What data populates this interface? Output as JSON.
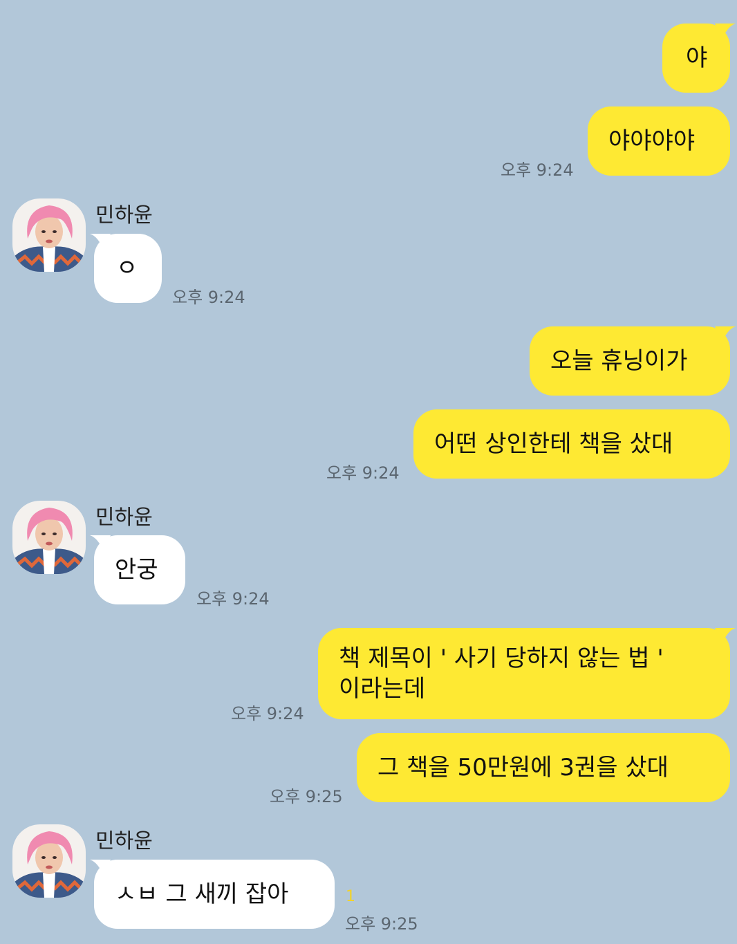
{
  "contact": {
    "name": "민하윤"
  },
  "colors": {
    "background": "#b2c7d9",
    "mine_bubble": "#fee933",
    "their_bubble": "#ffffff",
    "time_text": "#5b6670",
    "unread": "#f3d326"
  },
  "messages": [
    {
      "from": "me",
      "text": "야"
    },
    {
      "from": "me",
      "text": "야야야야",
      "time": "오후 9:24"
    },
    {
      "from": "contact",
      "sender": "민하윤",
      "text": "ㅇ",
      "time": "오후 9:24"
    },
    {
      "from": "me",
      "text": "오늘 휴닝이가"
    },
    {
      "from": "me",
      "text": "어떤 상인한테 책을 샀대",
      "time": "오후 9:24"
    },
    {
      "from": "contact",
      "sender": "민하윤",
      "text": "안궁",
      "time": "오후 9:24"
    },
    {
      "from": "me",
      "text_lines": [
        "책 제목이 ' 사기 당하지 않는 법 '",
        "이라는데"
      ],
      "time": "오후 9:24"
    },
    {
      "from": "me",
      "text": "그 책을 50만원에 3권을 샀대",
      "time": "오후 9:25"
    },
    {
      "from": "contact",
      "sender": "민하윤",
      "text": "ㅅㅂ 그 새끼 잡아",
      "time": "오후 9:25",
      "unread_count": "1"
    }
  ]
}
